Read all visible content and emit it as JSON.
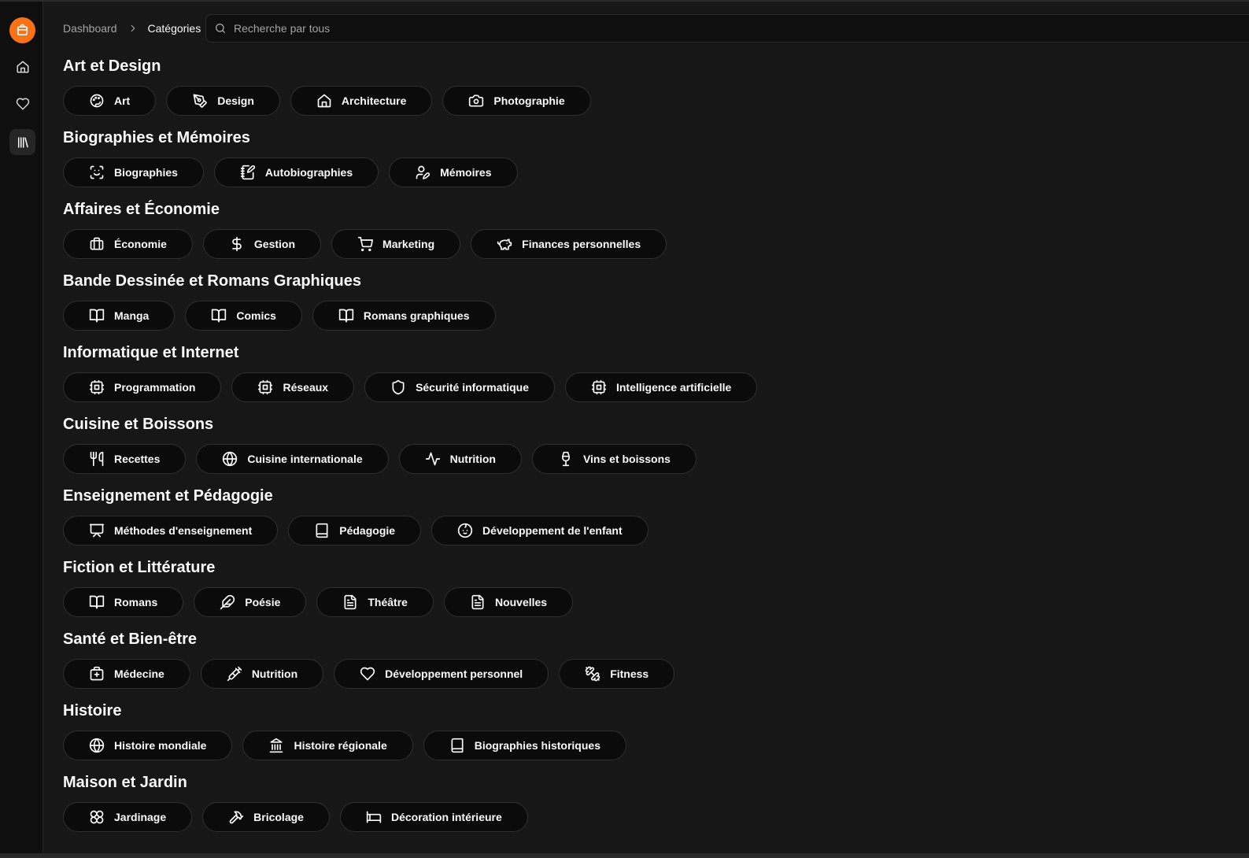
{
  "header": {
    "breadcrumb": [
      {
        "label": "Dashboard"
      },
      {
        "label": "Catégories"
      }
    ],
    "search": {
      "placeholder": "Recherche par tous"
    }
  },
  "sidebar": {
    "items": [
      {
        "name": "brand",
        "icon": "shopping-bag-icon"
      },
      {
        "name": "home",
        "icon": "home-icon"
      },
      {
        "name": "favorites",
        "icon": "heart-icon"
      },
      {
        "name": "library",
        "icon": "library-icon",
        "active": true
      }
    ],
    "accent_color": "#f97316"
  },
  "sections": [
    {
      "title": "Art et Design",
      "categories": [
        {
          "label": "Art",
          "icon": "palette"
        },
        {
          "label": "Design",
          "icon": "pen-tool"
        },
        {
          "label": "Architecture",
          "icon": "home"
        },
        {
          "label": "Photographie",
          "icon": "camera"
        }
      ]
    },
    {
      "title": "Biographies et Mémoires",
      "categories": [
        {
          "label": "Biographies",
          "icon": "scan-face"
        },
        {
          "label": "Autobiographies",
          "icon": "notebook-pen"
        },
        {
          "label": "Mémoires",
          "icon": "user-pen"
        }
      ]
    },
    {
      "title": "Affaires et Économie",
      "categories": [
        {
          "label": "Économie",
          "icon": "briefcase"
        },
        {
          "label": "Gestion",
          "icon": "dollar"
        },
        {
          "label": "Marketing",
          "icon": "cart"
        },
        {
          "label": "Finances personnelles",
          "icon": "piggy-bank"
        }
      ]
    },
    {
      "title": "Bande Dessinée et Romans Graphiques",
      "categories": [
        {
          "label": "Manga",
          "icon": "book-open"
        },
        {
          "label": "Comics",
          "icon": "book-open"
        },
        {
          "label": "Romans graphiques",
          "icon": "book-open"
        }
      ]
    },
    {
      "title": "Informatique et Internet",
      "categories": [
        {
          "label": "Programmation",
          "icon": "cpu"
        },
        {
          "label": "Réseaux",
          "icon": "cpu"
        },
        {
          "label": "Sécurité informatique",
          "icon": "shield"
        },
        {
          "label": "Intelligence artificielle",
          "icon": "cpu"
        }
      ]
    },
    {
      "title": "Cuisine et Boissons",
      "categories": [
        {
          "label": "Recettes",
          "icon": "utensils"
        },
        {
          "label": "Cuisine internationale",
          "icon": "globe"
        },
        {
          "label": "Nutrition",
          "icon": "activity"
        },
        {
          "label": "Vins et boissons",
          "icon": "wine"
        }
      ]
    },
    {
      "title": "Enseignement et Pédagogie",
      "categories": [
        {
          "label": "Méthodes d'enseignement",
          "icon": "presentation"
        },
        {
          "label": "Pédagogie",
          "icon": "book"
        },
        {
          "label": "Développement de l'enfant",
          "icon": "baby"
        }
      ]
    },
    {
      "title": "Fiction et Littérature",
      "categories": [
        {
          "label": "Romans",
          "icon": "book-open"
        },
        {
          "label": "Poésie",
          "icon": "feather"
        },
        {
          "label": "Théâtre",
          "icon": "file-text"
        },
        {
          "label": "Nouvelles",
          "icon": "file-text"
        }
      ]
    },
    {
      "title": "Santé et Bien-être",
      "categories": [
        {
          "label": "Médecine",
          "icon": "medkit"
        },
        {
          "label": "Nutrition",
          "icon": "syringe"
        },
        {
          "label": "Développement personnel",
          "icon": "heart"
        },
        {
          "label": "Fitness",
          "icon": "dumbbell"
        }
      ]
    },
    {
      "title": "Histoire",
      "categories": [
        {
          "label": "Histoire mondiale",
          "icon": "globe"
        },
        {
          "label": "Histoire régionale",
          "icon": "landmark"
        },
        {
          "label": "Biographies historiques",
          "icon": "book"
        }
      ]
    },
    {
      "title": "Maison et Jardin",
      "categories": [
        {
          "label": "Jardinage",
          "icon": "flower"
        },
        {
          "label": "Bricolage",
          "icon": "hammer"
        },
        {
          "label": "Décoration intérieure",
          "icon": "bed"
        }
      ]
    }
  ]
}
